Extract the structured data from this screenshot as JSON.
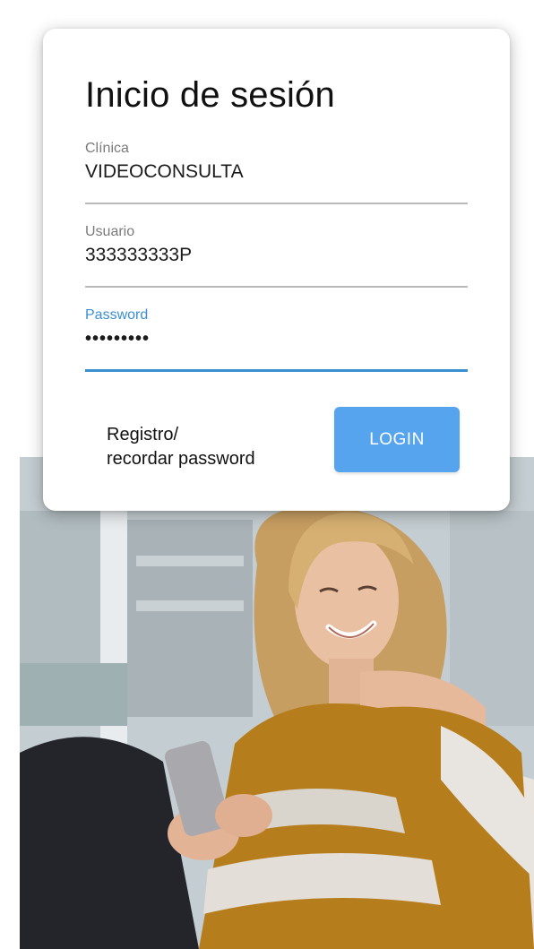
{
  "login": {
    "title": "Inicio de sesión",
    "clinic": {
      "label": "Clínica",
      "value": "VIDEOCONSULTA"
    },
    "user": {
      "label": "Usuario",
      "value": "333333333P"
    },
    "password": {
      "label": "Password",
      "value": "•••••••••"
    },
    "register_link": "Registro/\nrecordar password",
    "login_button": "LOGIN"
  },
  "colors": {
    "accent": "#3a8fd0",
    "button": "#57a4ee",
    "divider": "#b9b9b9"
  },
  "hero": {
    "description_icon": "woman-with-phone-photo"
  }
}
